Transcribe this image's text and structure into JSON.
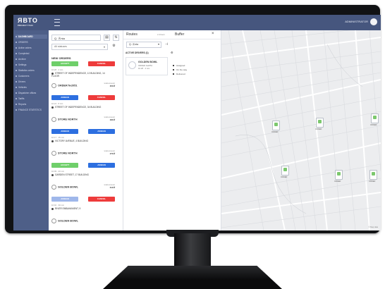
{
  "app": {
    "logo_text": "ЯВТО",
    "logo_sub": "PROJECT TAXI",
    "user_name": "ADMINISTRATOR"
  },
  "sidebar": {
    "items": [
      {
        "label": "DASHBOARD",
        "active": true
      },
      {
        "label": "ORDERS",
        "active": false
      },
      {
        "label": "Active orders",
        "active": false
      },
      {
        "label": "Completed",
        "active": false
      },
      {
        "label": "Archive",
        "active": false
      },
      {
        "label": "Settings",
        "active": false
      },
      {
        "label": "Statistics orders",
        "active": false
      },
      {
        "label": "Customers",
        "active": false
      },
      {
        "label": "Drivers",
        "active": false
      },
      {
        "label": "Vehicles",
        "active": false
      },
      {
        "label": "Dispatcher offices",
        "active": false
      },
      {
        "label": "Tariffs",
        "active": false
      },
      {
        "label": "Reports",
        "active": false
      },
      {
        "label": "FINANCE STATISTICS",
        "active": false
      }
    ]
  },
  "orders": {
    "search_value": "Q. Ⓐnta",
    "filter_placeholder": "All statuses",
    "section_title": "NEW ORDERS",
    "rows": [
      {
        "primary": "ACCEPT",
        "primary_color": "green",
        "secondary": "CANCEL",
        "secondary_color": "red",
        "time": "10:28 · 4 min",
        "address": "STREET OF INDEPENDENCE, 12 BUILDING, 14 FLOOR",
        "store": "ORDER №2051",
        "meta": "total amount",
        "meta2": "350 ₽"
      },
      {
        "primary": "ASSIGN",
        "primary_color": "blue",
        "secondary": "CANCEL",
        "secondary_color": "red",
        "time": "10:24 · 8 min",
        "address": "STREET OF INDEPENDENCE, 34 BUILDING",
        "store": "STORE NORTH",
        "meta": "total amount",
        "meta2": "480 ₽"
      },
      {
        "primary": "ASSIGN",
        "primary_color": "blue",
        "secondary": "ASSIGN",
        "secondary_color": "blue",
        "time": "10:17 · 15 min",
        "address": "VICTORY AVENUE, 4 BUILDING",
        "store": "STORE NORTH",
        "meta": "total amount",
        "meta2": "270 ₽"
      },
      {
        "primary": "ACCEPT",
        "primary_color": "green",
        "secondary": "ASSIGN",
        "secondary_color": "blue",
        "time": "10:09 · 23 min",
        "address": "GARDEN STREET, 17 BUILDING",
        "store": "GOLDEN BOWL",
        "meta": "total amount",
        "meta2": "610 ₽"
      },
      {
        "primary": "ASSIGN",
        "primary_color": "lblue",
        "secondary": "CANCEL",
        "secondary_color": "red",
        "time": "10:02 · 30 min",
        "address": "RIVER EMBANKMENT, 9",
        "store": "GOLDEN BOWL",
        "meta": "",
        "meta2": ""
      }
    ]
  },
  "dispatch": {
    "tab_routes": "Routes",
    "tab_routes_meta": "2 drivers",
    "tab_buffer": "Buffer",
    "search_value": "Q. Ⓐnta",
    "drivers_label": "ACTIVE DRIVERS (1)",
    "drivers_count": "1",
    "driver": {
      "name": "GOLDEN BOWL",
      "sub": "ORDER №2051",
      "time": "10:28 · 4 min"
    },
    "legend": [
      "Assigned",
      "On the way",
      "Delivered"
    ]
  },
  "map": {
    "markers": [
      {
        "label": "ORDER"
      },
      {
        "label": "ORDER"
      },
      {
        "label": "ORDER"
      },
      {
        "label": "ORDER"
      },
      {
        "label": "ORDER"
      },
      {
        "label": "ORDER"
      }
    ],
    "credit": "© Map data"
  }
}
